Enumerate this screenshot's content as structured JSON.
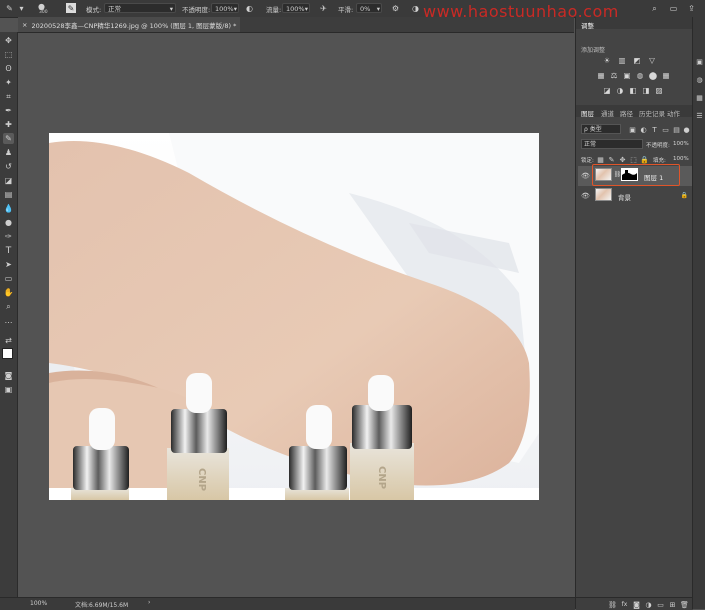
{
  "options_bar": {
    "brush_size": "300",
    "mode_label": "模式:",
    "mode_value": "正常",
    "opacity_label": "不透明度:",
    "opacity_value": "100%",
    "flow_label": "流量:",
    "flow_value": "100%",
    "smoothing_label": "平滑:",
    "smoothing_value": "0%"
  },
  "watermark": "www.haostuunhao.com",
  "document_tab": {
    "title": "20200528李鑫—CNP精华1269.jpg @ 100% (图层 1, 图层蒙版/8) *",
    "close": "×"
  },
  "status_bar": {
    "zoom": "100%",
    "doc_info": "文档:6.69M/15.6M",
    "arrow": "›"
  },
  "adjustments_panel": {
    "tab": "调整",
    "subtitle": "添加调整",
    "icons_row1": [
      "☀",
      "▥",
      "◩",
      "▽"
    ],
    "icons_row2": [
      "▦",
      "⚖",
      "▣",
      "◍",
      "⬤",
      "▦"
    ],
    "icons_row3": [
      "◪",
      "◑",
      "◧",
      "◨",
      "▨"
    ]
  },
  "layers_panel": {
    "tabs": [
      "图层",
      "通道",
      "路径",
      "历史记录",
      "动作"
    ],
    "filter_label": "ρ 类型",
    "blend_mode": "正常",
    "opacity_label": "不透明度:",
    "opacity_value": "100%",
    "lock_label": "锁定:",
    "fill_label": "填充:",
    "fill_value": "100%",
    "layers": [
      {
        "name": "图层 1",
        "visible": true,
        "selected": true,
        "has_mask": true
      },
      {
        "name": "背景",
        "visible": true,
        "selected": false,
        "locked": true
      }
    ],
    "footer_icons": [
      "link-icon",
      "fx-icon",
      "mask-icon",
      "adjustment-icon",
      "group-icon",
      "new-layer-icon",
      "trash-icon"
    ]
  },
  "product": {
    "bottle_text": "CNP"
  },
  "colors": {
    "highlight_box": "#e0552a",
    "canvas_bg": "#535353",
    "panel_bg": "#444444"
  }
}
